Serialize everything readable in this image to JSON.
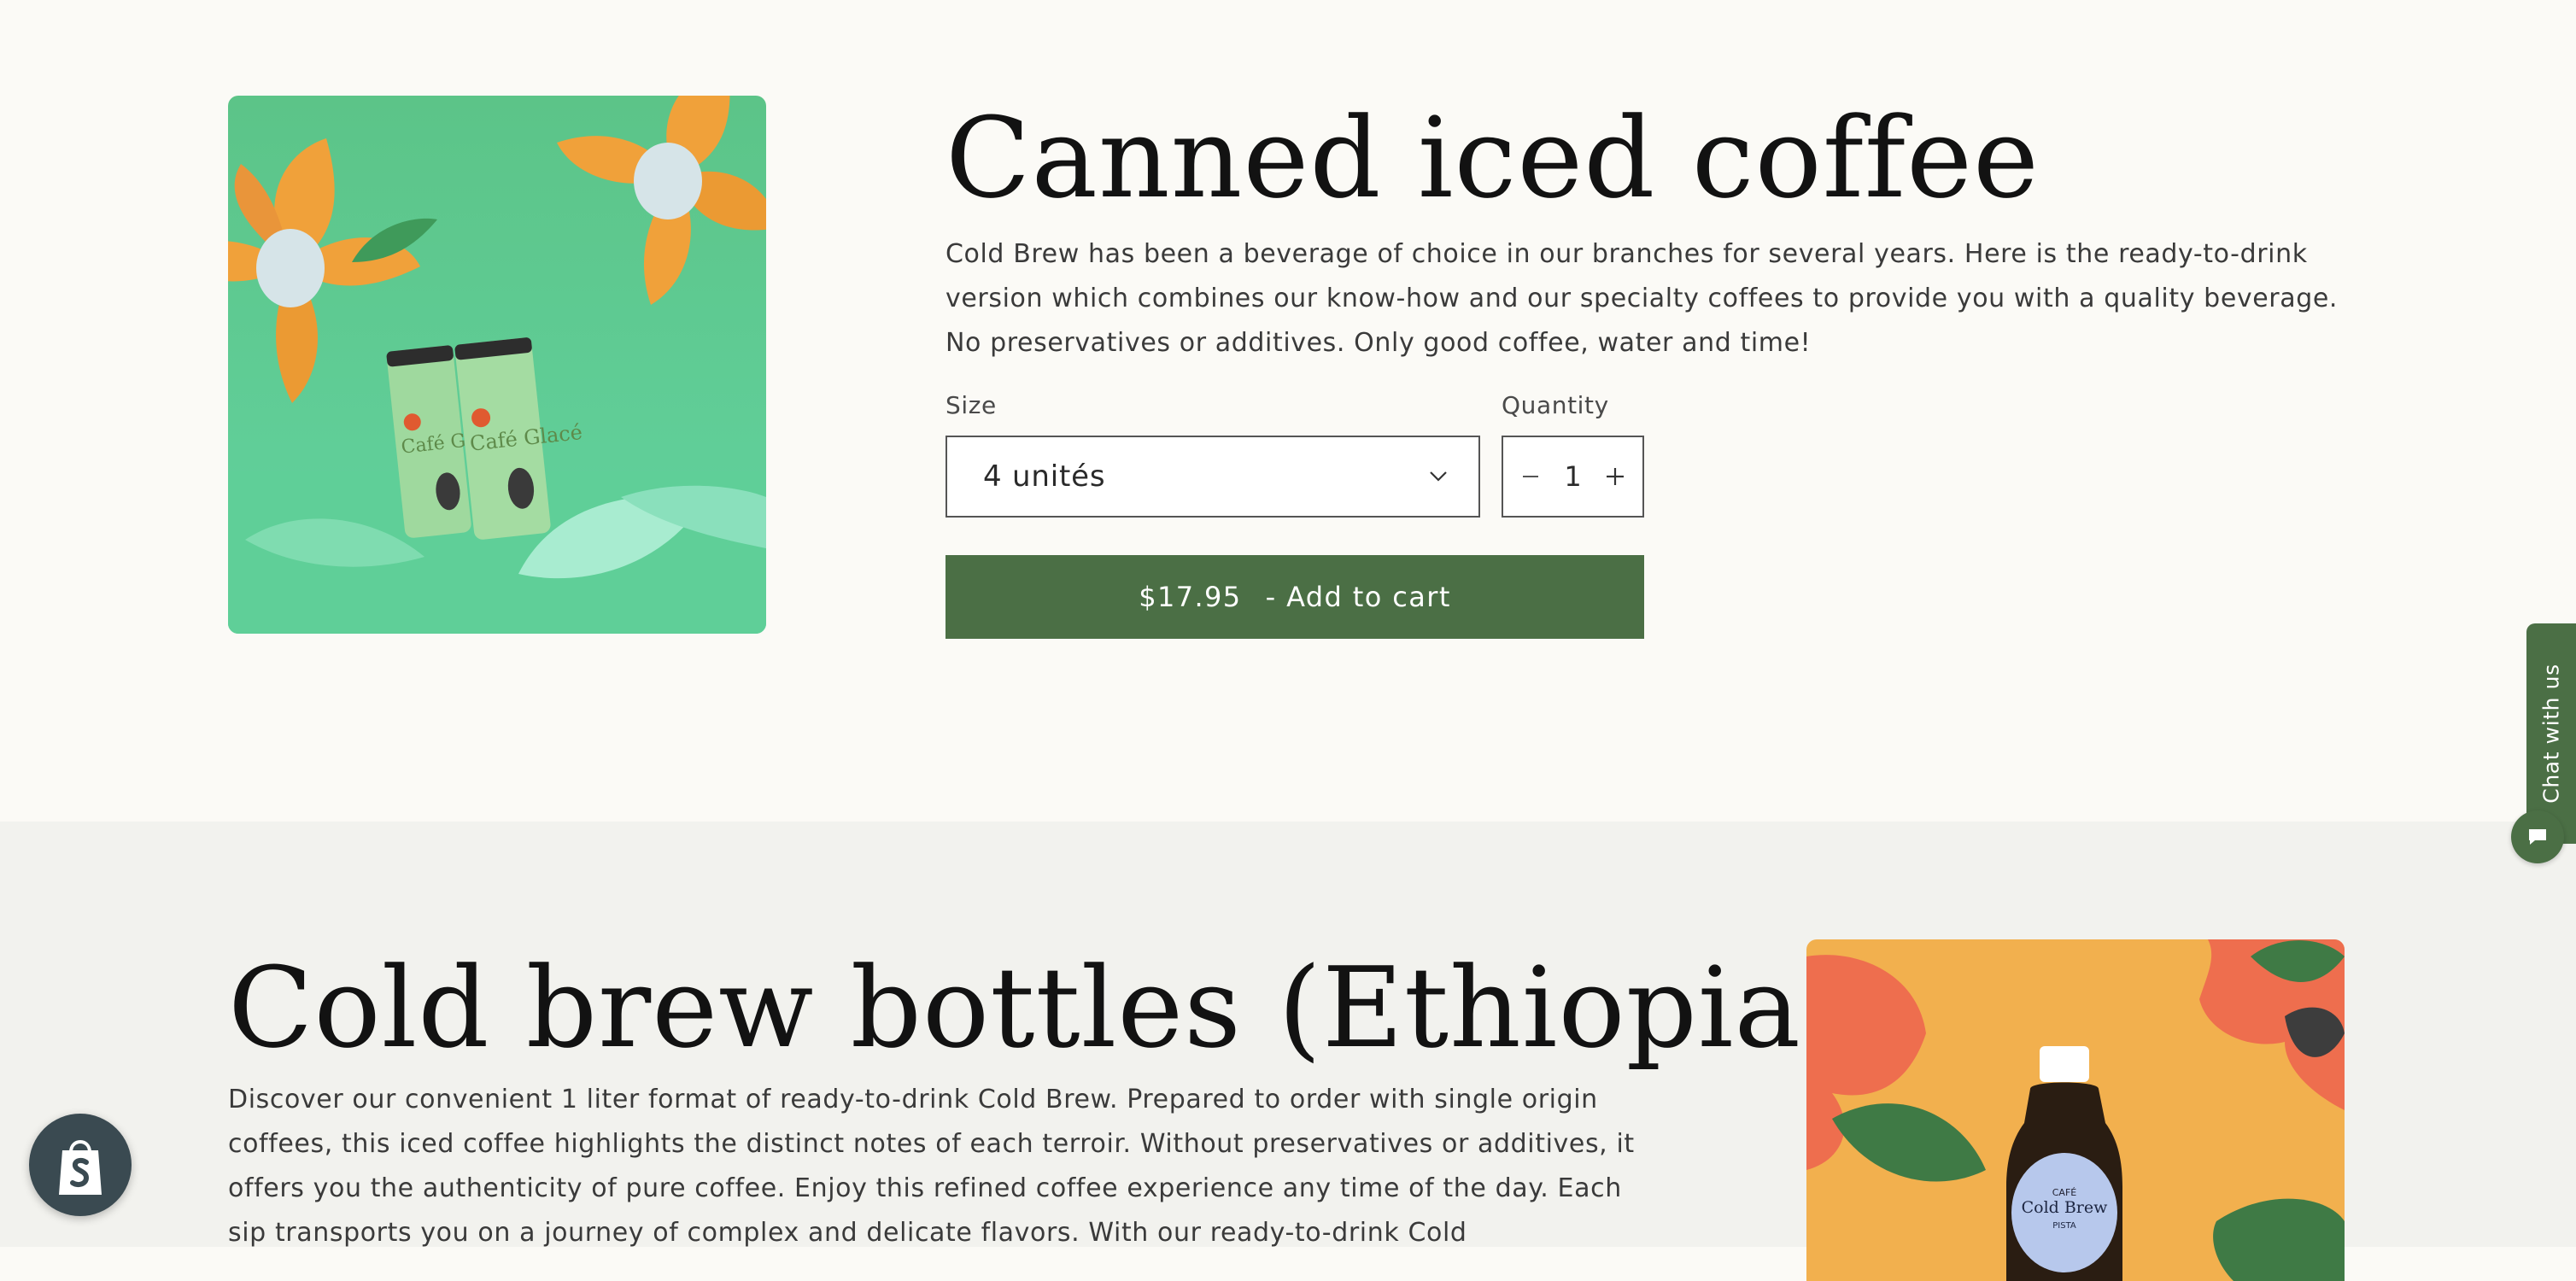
{
  "products": [
    {
      "title": "Canned iced coffee",
      "description": "Cold Brew has been a beverage of choice in our branches for several years. Here is the ready-to-drink version which combines our know-how and our specialty coffees to provide you with a quality beverage. No preservatives or additives. Only good coffee, water and time!",
      "size_label": "Size",
      "size_selected": "4 unités",
      "quantity_label": "Quantity",
      "quantity_value": "1",
      "price": "$17.95",
      "add_to_cart_label": "- Add to cart",
      "image_can_text": "Café Glacé"
    },
    {
      "title": "Cold brew bottles (Ethiopia)",
      "description": "Discover our convenient 1 liter format of ready-to-drink Cold Brew. Prepared to order with single origin coffees, this iced coffee highlights the distinct notes of each terroir. Without preservatives or additives, it offers you the authenticity of pure coffee. Enjoy this refined coffee experience any time of the day. Each sip transports you on a journey of complex and delicate flavors. With our ready-to-drink Cold",
      "image_bottle_small": "CAFÉ",
      "image_bottle_text": "Cold Brew",
      "image_bottle_brand": "PISTA"
    }
  ],
  "chat": {
    "tab_label": "Chat with us"
  },
  "icons": {
    "chevron": "chevron-down-icon",
    "minus": "minus-icon",
    "plus": "plus-icon",
    "chat": "chat-icon",
    "shop": "shopify-bag-icon"
  },
  "colors": {
    "accent": "#4b6f45",
    "page_bg": "#fbfaf6",
    "section_bg": "#f2f2ee",
    "title": "#121212"
  }
}
